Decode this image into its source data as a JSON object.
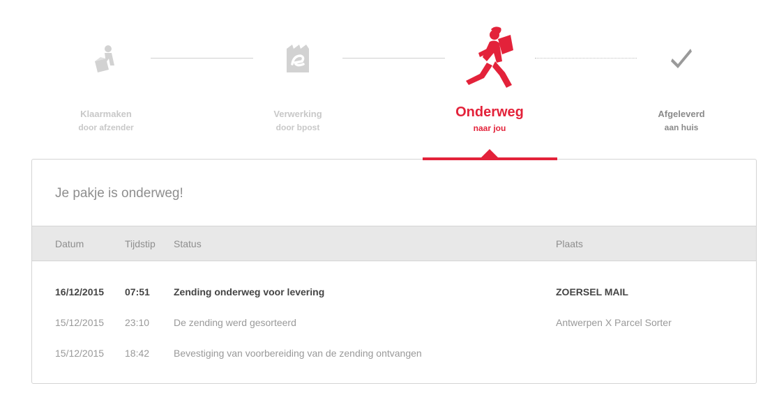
{
  "steps": [
    {
      "title": "Klaarmaken",
      "subtitle": "door afzender",
      "icon": "person-box-icon",
      "state": "done"
    },
    {
      "title": "Verwerking",
      "subtitle": "door bpost",
      "icon": "bpost-logo-icon",
      "state": "done"
    },
    {
      "title": "Onderweg",
      "subtitle": "naar jou",
      "icon": "running-courier-icon",
      "state": "active"
    },
    {
      "title": "Afgeleverd",
      "subtitle": "aan huis",
      "icon": "checkmark-icon",
      "state": "todo"
    }
  ],
  "colors": {
    "accent": "#e3223a",
    "muted": "#c8c8c8",
    "header_bg": "#e8e8e8"
  },
  "panel": {
    "title": "Je pakje is onderweg!",
    "columns": {
      "date": "Datum",
      "time": "Tijdstip",
      "status": "Status",
      "place": "Plaats"
    },
    "rows": [
      {
        "date": "16/12/2015",
        "time": "07:51",
        "status": "Zending onderweg voor levering",
        "place": "ZOERSEL MAIL",
        "highlight": true
      },
      {
        "date": "15/12/2015",
        "time": "23:10",
        "status": "De zending werd gesorteerd",
        "place": "Antwerpen X Parcel Sorter",
        "highlight": false
      },
      {
        "date": "15/12/2015",
        "time": "18:42",
        "status": "Bevestiging van voorbereiding van de zending ontvangen",
        "place": "",
        "highlight": false
      }
    ]
  }
}
